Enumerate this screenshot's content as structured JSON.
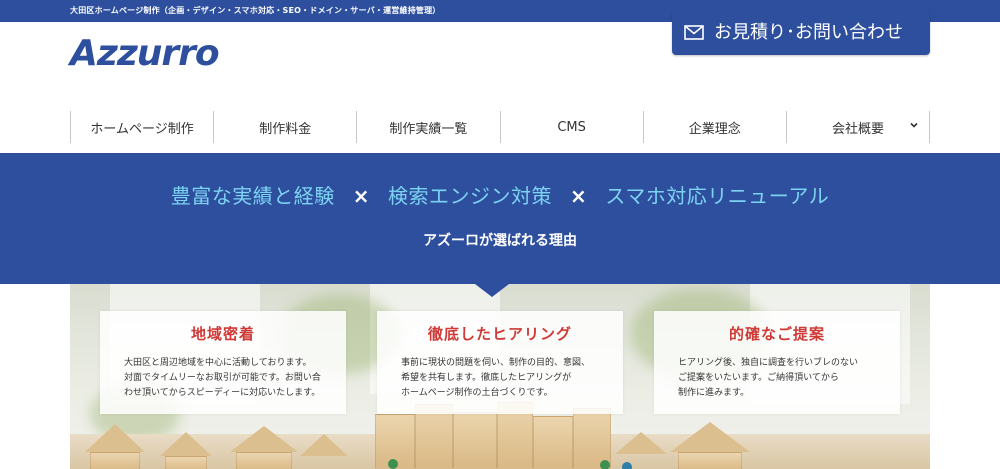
{
  "topbar": {
    "text": "大田区ホームページ制作（企画・デザイン・スマホ対応・SEO・ドメイン・サーバ・運営維持管理）"
  },
  "logo": {
    "text": "Azzurro"
  },
  "contact": {
    "label": "お見積り･お問い合わせ",
    "icon": "mail-icon"
  },
  "nav": {
    "items": [
      {
        "label": "ホームページ制作"
      },
      {
        "label": "制作料金"
      },
      {
        "label": "制作実績一覧"
      },
      {
        "label": "CMS"
      },
      {
        "label": "企業理念"
      },
      {
        "label": "会社概要",
        "icon": "chevron-down-icon"
      }
    ]
  },
  "banner": {
    "tagline": {
      "part1": "豊富な実績と経験",
      "sep1": "×",
      "part2": "検索エンジン対策",
      "sep2": "×",
      "part3": "スマホ対応リニューアル"
    },
    "subtitle": "アズーロが選ばれる理由"
  },
  "features": [
    {
      "title": "地域密着",
      "lines": [
        "大田区と周辺地域を中心に活動しております。",
        "対面でタイムリーなお取引が可能です。お問い合",
        "わせ頂いてからスピーディーに対応いたします。"
      ]
    },
    {
      "title": "徹底したヒアリング",
      "lines": [
        "事前に現状の問題を伺い、制作の目的、意図、",
        "希望を共有します。徹底したヒアリングが",
        "ホームページ制作の土台づくりです。"
      ]
    },
    {
      "title": "的確なご提案",
      "lines": [
        "ヒアリング後、独自に調査を行いブレのない",
        "ご提案をいたいます。ご納得頂いてから",
        "制作に進みます。"
      ]
    }
  ],
  "colors": {
    "brand": "#2d4f9e",
    "tagline": "#7dd3f2",
    "feature_title": "#cf3a37"
  }
}
